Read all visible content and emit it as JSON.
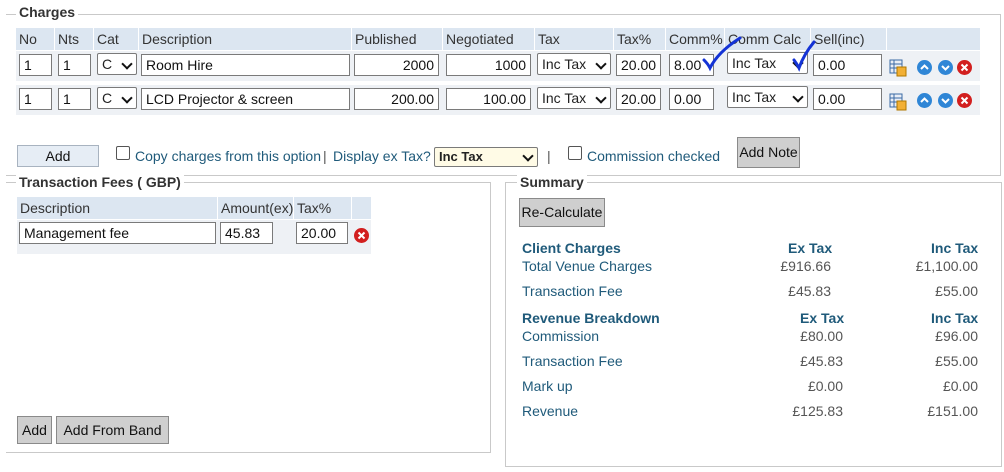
{
  "charges": {
    "legend": "Charges",
    "headers": {
      "no": "No",
      "nts": "Nts",
      "cat": "Cat",
      "description": "Description",
      "published": "Published",
      "negotiated": "Negotiated",
      "tax": "Tax",
      "tax_pct": "Tax%",
      "comm_pct": "Comm%",
      "comm_calc": "Comm Calc",
      "sell_inc": "Sell(inc)"
    },
    "rows": [
      {
        "no": "1",
        "nts": "1",
        "cat": "C",
        "description": "Room Hire",
        "published": "2000",
        "negotiated": "1000",
        "tax": "Inc Tax",
        "tax_pct": "20.00",
        "comm_pct": "8.00",
        "comm_calc": "Inc Tax",
        "sell_inc": "0.00"
      },
      {
        "no": "1",
        "nts": "1",
        "cat": "C",
        "description": "LCD Projector & screen",
        "published": "200.00",
        "negotiated": "100.00",
        "tax": "Inc Tax",
        "tax_pct": "20.00",
        "comm_pct": "0.00",
        "comm_calc": "Inc Tax",
        "sell_inc": "0.00"
      }
    ],
    "add_label": "Add",
    "copy_label": "Copy charges from this option",
    "separator": "|",
    "display_ex_tax_label": "Display ex Tax?",
    "display_ex_tax_value": "Inc Tax",
    "separator2": "|",
    "commission_checked_label": "Commission checked",
    "add_note_label": "Add Note",
    "checkmark_color": "#1433d6"
  },
  "transaction_fees": {
    "legend": "Transaction Fees ( GBP)",
    "headers": {
      "description": "Description",
      "amount": "Amount(ex)",
      "tax_pct": "Tax%"
    },
    "rows": [
      {
        "description": "Management fee",
        "amount": "45.83",
        "tax_pct": "20.00"
      }
    ],
    "add_label": "Add",
    "add_from_band_label": "Add From Band"
  },
  "summary": {
    "legend": "Summary",
    "recalculate_label": "Re-Calculate",
    "client_charges": {
      "heading": "Client Charges",
      "ex_tax": "Ex Tax",
      "inc_tax": "Inc Tax",
      "rows": [
        {
          "label": "Total Venue Charges",
          "ex": "£916.66",
          "inc": "£1,100.00"
        },
        {
          "label": "Transaction Fee",
          "ex": "£45.83",
          "inc": "£55.00"
        }
      ]
    },
    "revenue": {
      "heading": "Revenue Breakdown",
      "ex_tax": "Ex Tax",
      "inc_tax": "Inc Tax",
      "rows": [
        {
          "label": "Commission",
          "ex": "£80.00",
          "inc": "£96.00"
        },
        {
          "label": "Transaction Fee",
          "ex": "£45.83",
          "inc": "£55.00"
        },
        {
          "label": "Mark up",
          "ex": "£0.00",
          "inc": "£0.00"
        },
        {
          "label": "Revenue",
          "ex": "£125.83",
          "inc": "£151.00"
        }
      ]
    }
  }
}
